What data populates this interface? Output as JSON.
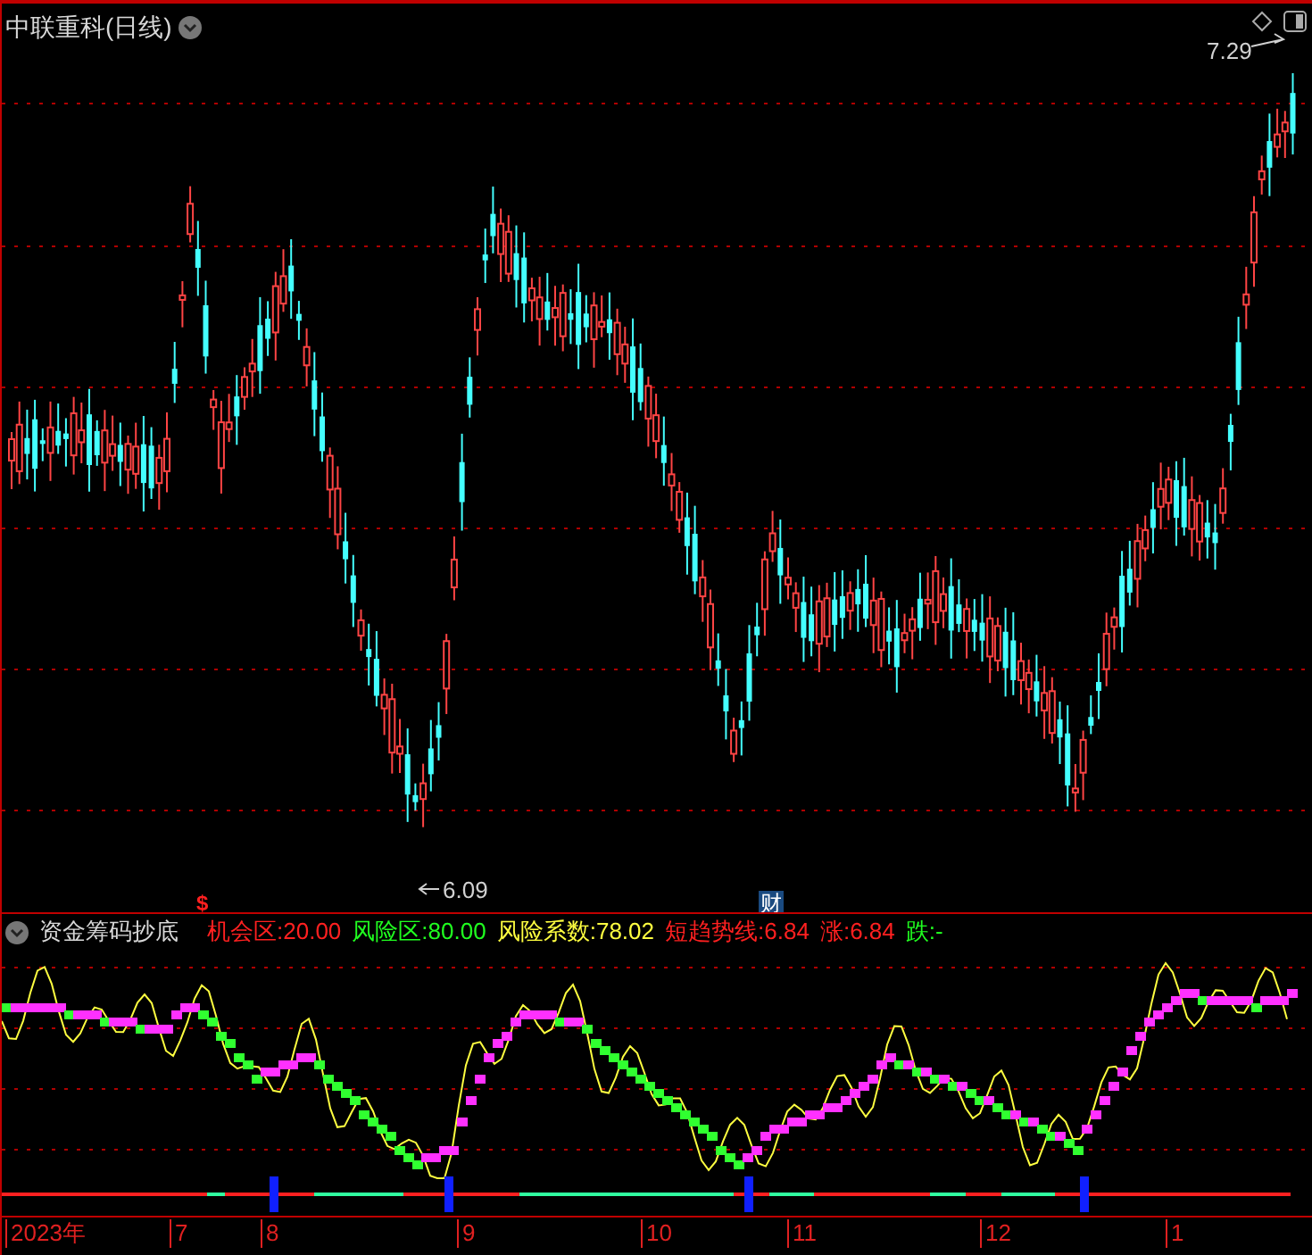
{
  "chart": {
    "title": "中联重科(日线)",
    "high_label": "7.29",
    "low_label": "6.09",
    "markers": [
      {
        "kind": "dividend",
        "text": "$"
      },
      {
        "kind": "finance",
        "text": "财"
      }
    ]
  },
  "indicator": {
    "name": "资金筹码抄底",
    "values": [
      {
        "label": "机会区:",
        "value": "20.00",
        "color": "#ff2020"
      },
      {
        "label": "风险区:",
        "value": "80.00",
        "color": "#20ff20"
      },
      {
        "label": "风险系数:",
        "value": "78.02",
        "color": "#ffff40"
      },
      {
        "label": "短趋势线:",
        "value": "6.84",
        "color": "#ff2020"
      },
      {
        "label": "涨:",
        "value": "6.84",
        "color": "#ff2020"
      },
      {
        "label": "跌:",
        "value": "-",
        "color": "#20ff20"
      }
    ]
  },
  "x_axis": {
    "labels": [
      "2023年",
      "7",
      "8",
      "9",
      "10",
      "11",
      "12",
      "1"
    ]
  }
}
